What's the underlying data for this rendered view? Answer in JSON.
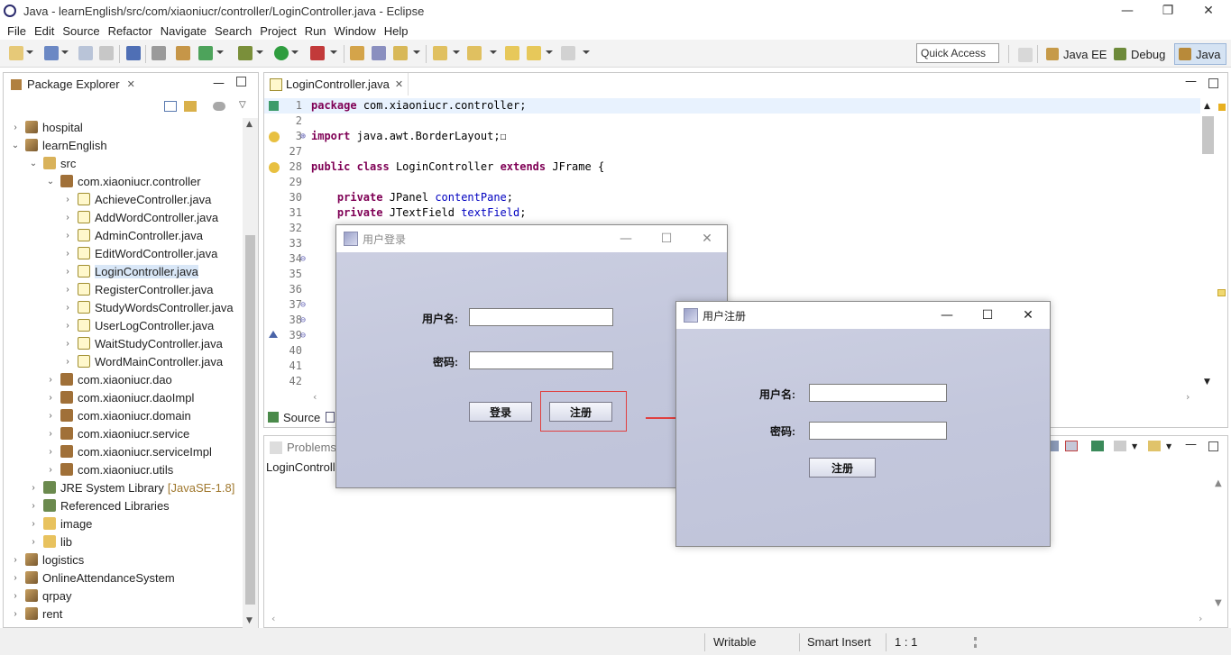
{
  "window": {
    "title": "Java - learnEnglish/src/com/xiaoniucr/controller/LoginController.java - Eclipse",
    "minimize": "—",
    "restore": "❐",
    "close": "✕"
  },
  "menu": [
    "File",
    "Edit",
    "Source",
    "Refactor",
    "Navigate",
    "Search",
    "Project",
    "Run",
    "Window",
    "Help"
  ],
  "toolbar": {
    "quick_access": "Quick Access",
    "perspectives": [
      "Java EE",
      "Debug",
      "Java"
    ]
  },
  "package_explorer": {
    "title": "Package Explorer",
    "close": "✕",
    "tree": [
      {
        "label": "hospital",
        "level": 0,
        "expand": "›",
        "icon": "project-icon"
      },
      {
        "label": "learnEnglish",
        "level": 0,
        "expand": "⌄",
        "icon": "project-icon"
      },
      {
        "label": "src",
        "level": 1,
        "expand": "⌄",
        "icon": "source-folder-icon"
      },
      {
        "label": "com.xiaoniucr.controller",
        "level": 2,
        "expand": "⌄",
        "icon": "package-icon"
      },
      {
        "label": "AchieveController.java",
        "level": 3,
        "expand": "›",
        "icon": "java-file-icon"
      },
      {
        "label": "AddWordController.java",
        "level": 3,
        "expand": "›",
        "icon": "java-file-icon"
      },
      {
        "label": "AdminController.java",
        "level": 3,
        "expand": "›",
        "icon": "java-file-icon"
      },
      {
        "label": "EditWordController.java",
        "level": 3,
        "expand": "›",
        "icon": "java-file-icon"
      },
      {
        "label": "LoginController.java",
        "level": 3,
        "expand": "›",
        "icon": "java-file-icon",
        "selected": true
      },
      {
        "label": "RegisterController.java",
        "level": 3,
        "expand": "›",
        "icon": "java-file-icon"
      },
      {
        "label": "StudyWordsController.java",
        "level": 3,
        "expand": "›",
        "icon": "java-file-icon"
      },
      {
        "label": "UserLogController.java",
        "level": 3,
        "expand": "›",
        "icon": "java-file-icon"
      },
      {
        "label": "WaitStudyController.java",
        "level": 3,
        "expand": "›",
        "icon": "java-file-icon"
      },
      {
        "label": "WordMainController.java",
        "level": 3,
        "expand": "›",
        "icon": "java-file-icon"
      },
      {
        "label": "com.xiaoniucr.dao",
        "level": 2,
        "expand": "›",
        "icon": "package-icon"
      },
      {
        "label": "com.xiaoniucr.daoImpl",
        "level": 2,
        "expand": "›",
        "icon": "package-icon"
      },
      {
        "label": "com.xiaoniucr.domain",
        "level": 2,
        "expand": "›",
        "icon": "package-icon"
      },
      {
        "label": "com.xiaoniucr.service",
        "level": 2,
        "expand": "›",
        "icon": "package-icon"
      },
      {
        "label": "com.xiaoniucr.serviceImpl",
        "level": 2,
        "expand": "›",
        "icon": "package-icon"
      },
      {
        "label": "com.xiaoniucr.utils",
        "level": 2,
        "expand": "›",
        "icon": "package-icon"
      },
      {
        "label": "JRE System Library",
        "suffix": "[JavaSE-1.8]",
        "level": 1,
        "expand": "›",
        "icon": "library-icon"
      },
      {
        "label": "Referenced Libraries",
        "level": 1,
        "expand": "›",
        "icon": "library-icon"
      },
      {
        "label": "image",
        "level": 1,
        "expand": "›",
        "icon": "folder-icon"
      },
      {
        "label": "lib",
        "level": 1,
        "expand": "›",
        "icon": "folder-icon"
      },
      {
        "label": "logistics",
        "level": 0,
        "expand": "›",
        "icon": "project-icon"
      },
      {
        "label": "OnlineAttendanceSystem",
        "level": 0,
        "expand": "›",
        "icon": "project-icon"
      },
      {
        "label": "qrpay",
        "level": 0,
        "expand": "›",
        "icon": "project-icon"
      },
      {
        "label": "rent",
        "level": 0,
        "expand": "›",
        "icon": "project-icon"
      }
    ]
  },
  "editor": {
    "tab": "LoginController.java",
    "close": "✕",
    "lines": [
      {
        "n": "1",
        "code": "package com.xiaoniucr.controller;",
        "current": true
      },
      {
        "n": "2",
        "code": ""
      },
      {
        "n": "3",
        "code": "import java.awt.BorderLayout;☐",
        "fold": "⊕",
        "marker": "warning"
      },
      {
        "n": "27",
        "code": ""
      },
      {
        "n": "28",
        "code": "public class LoginController extends JFrame {",
        "marker": "warning"
      },
      {
        "n": "29",
        "code": ""
      },
      {
        "n": "30",
        "code": "    private JPanel contentPane;"
      },
      {
        "n": "31",
        "code": "    private JTextField textField;"
      },
      {
        "n": "32",
        "code": ""
      },
      {
        "n": "33",
        "code": ""
      },
      {
        "n": "34",
        "code": "",
        "fold": "⊖"
      },
      {
        "n": "35",
        "code": ""
      },
      {
        "n": "36",
        "code": ""
      },
      {
        "n": "37",
        "code": "",
        "fold": "⊖"
      },
      {
        "n": "38",
        "code": "",
        "fold": "⊖"
      },
      {
        "n": "39",
        "code": "",
        "fold": "⊖",
        "marker": "override"
      },
      {
        "n": "40",
        "code": ""
      },
      {
        "n": "41",
        "code": ""
      },
      {
        "n": "42",
        "code": ""
      }
    ],
    "bottom_tab": "Source"
  },
  "problems": {
    "title": "Problems",
    "crumb": "LoginControll"
  },
  "status": {
    "writable": "Writable",
    "insert_mode": "Smart Insert",
    "position": "1 : 1"
  },
  "login_dialog": {
    "title": "用户登录",
    "username_label": "用户名:",
    "password_label": "密码:",
    "username_value": "",
    "password_value": "",
    "login_button": "登录",
    "register_button": "注册"
  },
  "register_dialog": {
    "title": "用户注册",
    "username_label": "用户名:",
    "password_label": "密码:",
    "username_value": "",
    "password_value": "",
    "register_button": "注册"
  },
  "colors": {
    "annotation_red": "#e04040",
    "keyword": "#7f0055",
    "field": "#0000c0"
  }
}
